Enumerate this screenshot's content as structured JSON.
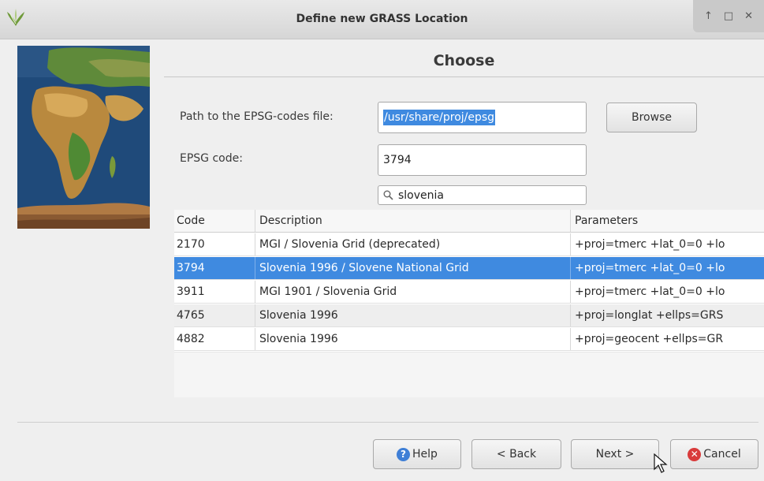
{
  "window": {
    "title": "Define new GRASS Location",
    "controls": [
      "↑",
      "□",
      "✕"
    ]
  },
  "page": {
    "section_title": "Choose"
  },
  "form": {
    "path_label": "Path to the EPSG-codes file:",
    "path_value": "/usr/share/proj/epsg",
    "browse_label": "Browse",
    "epsg_label": "EPSG code:",
    "epsg_value": "3794",
    "search_value": "slovenia"
  },
  "table": {
    "headers": [
      "Code",
      "Description",
      "Parameters"
    ],
    "rows": [
      {
        "code": "2170",
        "description": "MGI / Slovenia Grid (deprecated)",
        "parameters": "+proj=tmerc +lat_0=0 +lo"
      },
      {
        "code": "3794",
        "description": "Slovenia 1996 / Slovene National Grid",
        "parameters": "+proj=tmerc +lat_0=0 +lo"
      },
      {
        "code": "3911",
        "description": "MGI 1901 / Slovenia Grid",
        "parameters": "+proj=tmerc +lat_0=0 +lo"
      },
      {
        "code": "4765",
        "description": "Slovenia 1996",
        "parameters": "+proj=longlat +ellps=GRS"
      },
      {
        "code": "4882",
        "description": "Slovenia 1996",
        "parameters": "+proj=geocent +ellps=GR"
      }
    ],
    "selected_code": "3794"
  },
  "footer": {
    "help_label": "Help",
    "back_label": "< Back",
    "next_label": "Next >",
    "cancel_label": "Cancel"
  },
  "icons": {
    "help": "question-circle",
    "cancel": "close-circle",
    "search": "magnifier"
  },
  "colors": {
    "selection": "#3f8ae0",
    "help_icon": "#3f7fd6",
    "cancel_icon": "#d93b3b"
  }
}
